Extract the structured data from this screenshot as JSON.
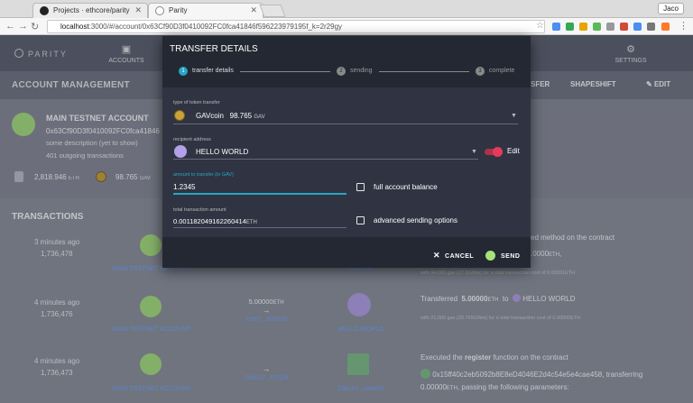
{
  "browser": {
    "tabs": [
      {
        "title": "Projects · ethcore/parity",
        "active": false
      },
      {
        "title": "Parity",
        "active": true
      }
    ],
    "profile_name": "Jaco",
    "url_host": "localhost",
    "url_path": ":3000/#/account/0x63Cf90D3f0410092FC0fca41846f596223979195f_k=2r29gy"
  },
  "app": {
    "logo_text": "PARITY",
    "nav": [
      {
        "label": "ACCOUNTS",
        "icon": "accounts-icon"
      },
      {
        "label": "SETTINGS",
        "icon": "gear-icon"
      }
    ],
    "subheader": {
      "title": "ACCOUNT MANAGEMENT",
      "actions": [
        "SFER",
        "SHAPESHIFT",
        "EDIT"
      ]
    }
  },
  "account": {
    "name": "MAIN TESTNET ACCOUNT",
    "address": "0x63Cf90D3f0410092FC0fca41846",
    "description": "some description (yet to show)",
    "tx_count": "401 outgoing transactions",
    "balances": [
      {
        "value": "2,818.946",
        "unit": "ETH"
      },
      {
        "value": "98.765",
        "unit": "GAV"
      }
    ]
  },
  "transactions": {
    "title": "TRANSACTIONS",
    "rows": [
      {
        "time": "3 minutes ago",
        "block": "1,736,478",
        "from": "MAIN TESTNET ACCOUNT",
        "amount": "",
        "amount_unit": "",
        "tx_link": "",
        "to": "GAVcoin",
        "desc": "ed method on the contract",
        "desc2": ".0000",
        "desc2_unit": "ETH",
        "desc2_tail": ","
      },
      {
        "time": "4 minutes ago",
        "block": "1,736,476",
        "from": "MAIN TESTNET ACCOUNT",
        "amount": "5.00000",
        "amount_unit": "ETH",
        "tx_link": "fc0e7...3e6599",
        "to": "HELLO WORLD",
        "desc": "Transferred",
        "desc_amount": "5.00000",
        "desc_unit": "ETH",
        "desc_to": "to",
        "desc_target": "HELLO WORLD",
        "desc_small": "with 21,000 gas (20.769GWei) for a total transaction cost of 0.00000ETH"
      },
      {
        "time": "4 minutes ago",
        "block": "1,736,473",
        "from": "MAIN TESTNET ACCOUNT",
        "amount": "",
        "amount_unit": "",
        "tx_link": "54b027...f7519f",
        "to": "158c43...cae458",
        "desc": "Executed the",
        "desc_fn": "register",
        "desc_tail": "function on the contract",
        "desc2": "0x15ff40c2eb5092b8E8eD4046E2d4c54e5e4cae458",
        "desc2_tail": ", transferring",
        "desc3": "0.00000",
        "desc3_unit": "ETH",
        "desc3_tail": ", passing the following parameters:"
      }
    ],
    "row0_small": "with 94,000 gas (27.8GWei) for a total transaction cost of 0.00261ETH"
  },
  "modal": {
    "title": "TRANSFER DETAILS",
    "steps": [
      {
        "num": "1",
        "label": "transfer details"
      },
      {
        "num": "2",
        "label": "sending"
      },
      {
        "num": "3",
        "label": "complete"
      }
    ],
    "token_label": "type of token transfer",
    "token_name": "GAVcoin",
    "token_balance": "98.765",
    "token_unit": "GAV",
    "recipient_label": "recipient address",
    "recipient_value": "HELLO WORLD",
    "edit_label": "Edit",
    "amount_label": "amount to transfer (in GAV)",
    "amount_value": "1.2345",
    "full_balance_label": "full account balance",
    "total_label": "total transaction amount",
    "total_value": "0.0011820491622604",
    "total_value_digits": "14",
    "total_unit": "ETH",
    "advanced_label": "advanced sending options",
    "cancel_label": "CANCEL",
    "send_label": "SEND"
  },
  "colors": {
    "accent": "#27a6c4",
    "link": "#6fa8ff",
    "toggle": "#e63a5a"
  }
}
